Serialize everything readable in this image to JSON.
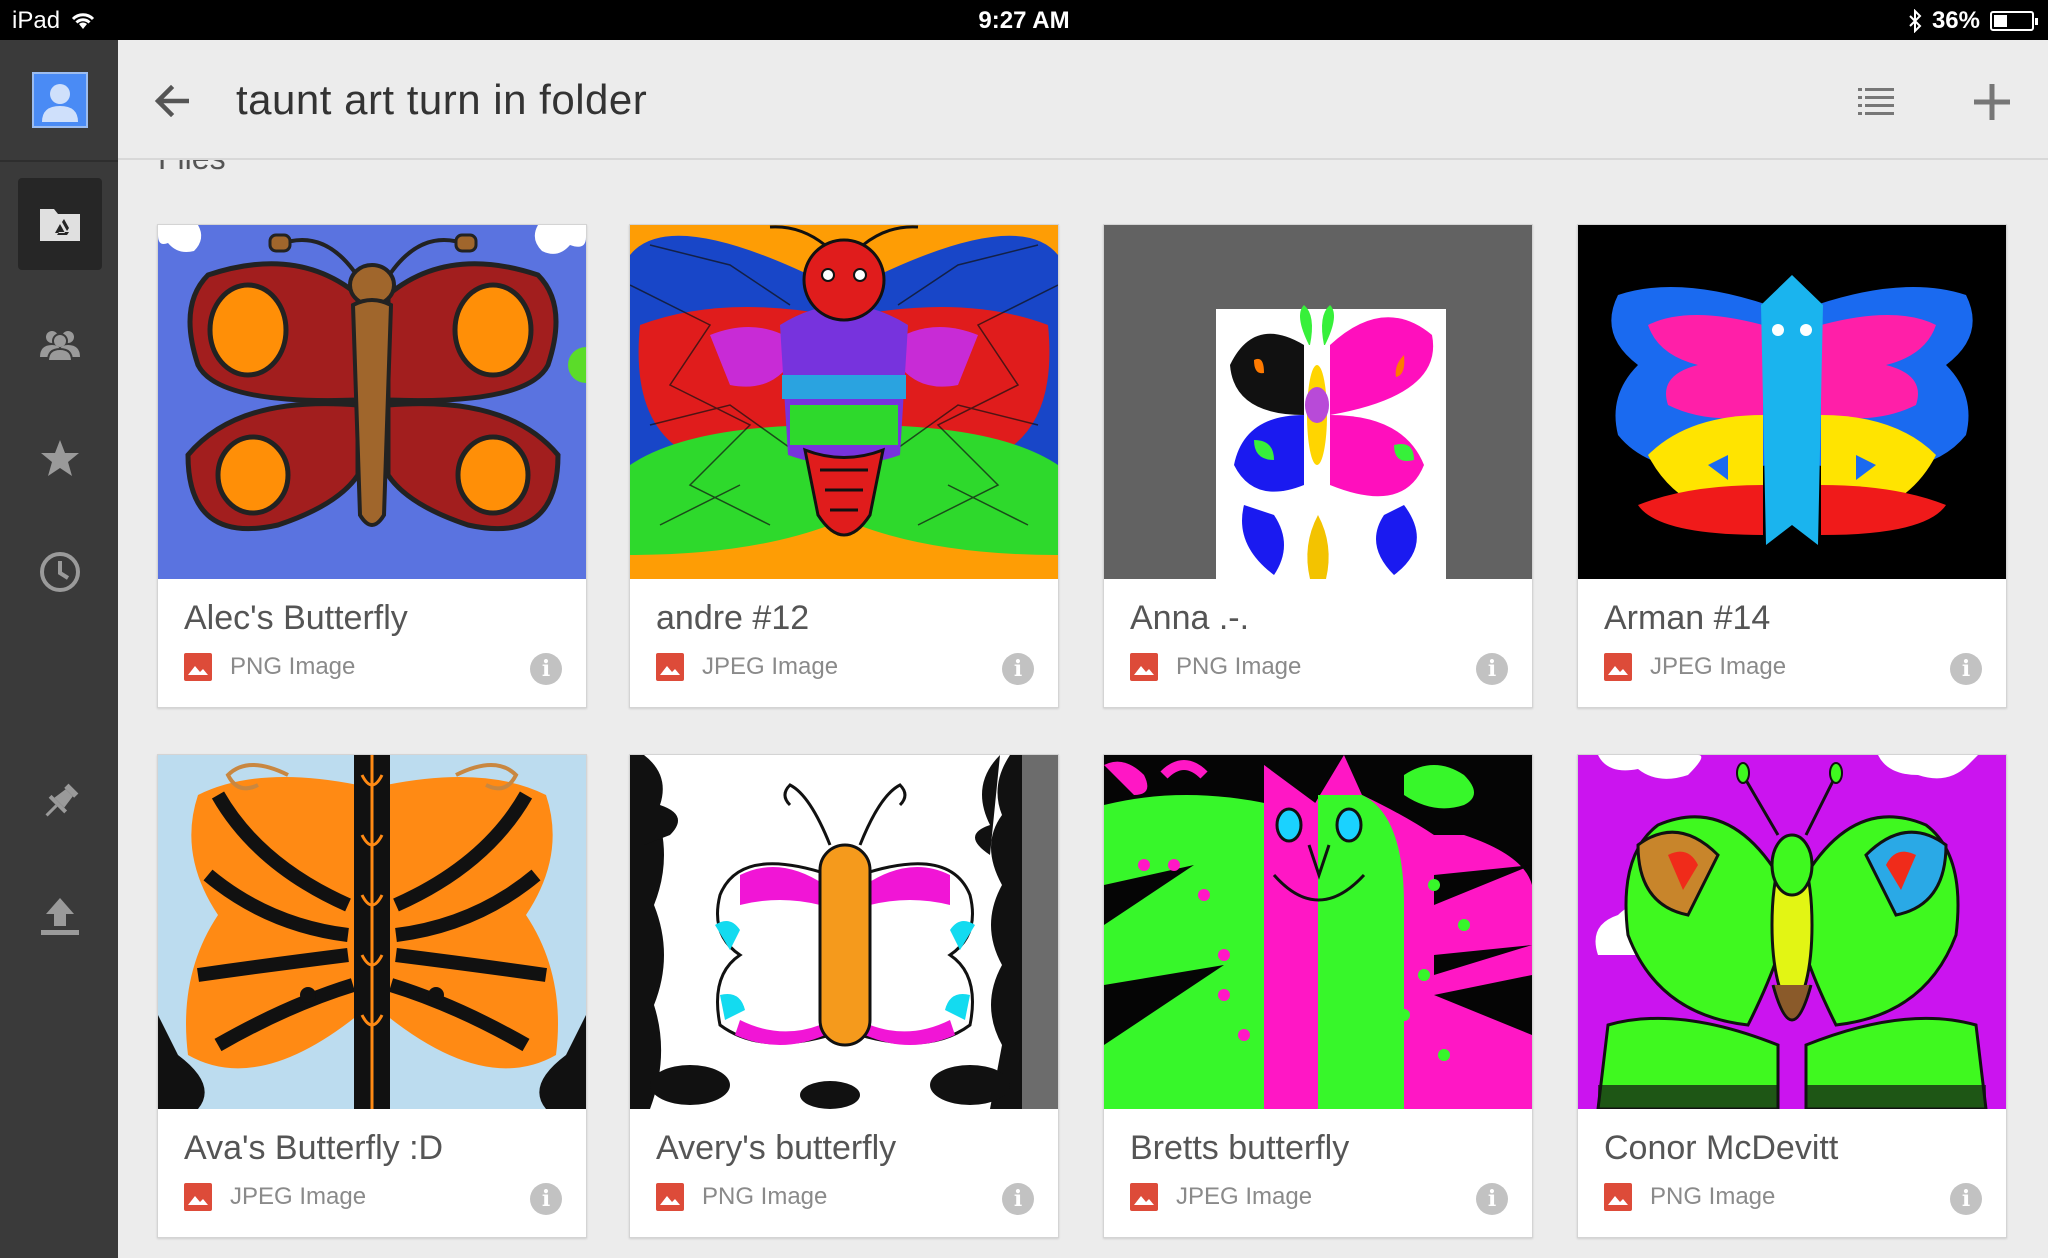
{
  "status_bar": {
    "device": "iPad",
    "time": "9:27 AM",
    "battery": "36%",
    "battery_level": 0.36
  },
  "header": {
    "title": "taunt art turn in folder"
  },
  "section": {
    "label": "Files"
  },
  "colors": {
    "sidebar": "#3a3a3a",
    "file_type_icon": "#dd4b39",
    "info_icon": "#c2c2c2"
  },
  "files": [
    {
      "name": "Alec's Butterfly",
      "type": "PNG Image"
    },
    {
      "name": "andre #12",
      "type": "JPEG Image"
    },
    {
      "name": "Anna .-.",
      "type": "PNG Image"
    },
    {
      "name": "Arman #14",
      "type": "JPEG Image"
    },
    {
      "name": "Ava's Butterfly :D",
      "type": "JPEG Image"
    },
    {
      "name": "Avery's butterfly",
      "type": "PNG Image"
    },
    {
      "name": "Bretts butterfly",
      "type": "JPEG Image"
    },
    {
      "name": "Conor McDevitt",
      "type": "PNG Image"
    }
  ],
  "sidebar_icons": [
    "account-avatar-icon",
    "my-drive-icon",
    "shared-with-me-icon",
    "starred-icon",
    "recent-icon",
    "offline-pin-icon",
    "upload-icon"
  ]
}
